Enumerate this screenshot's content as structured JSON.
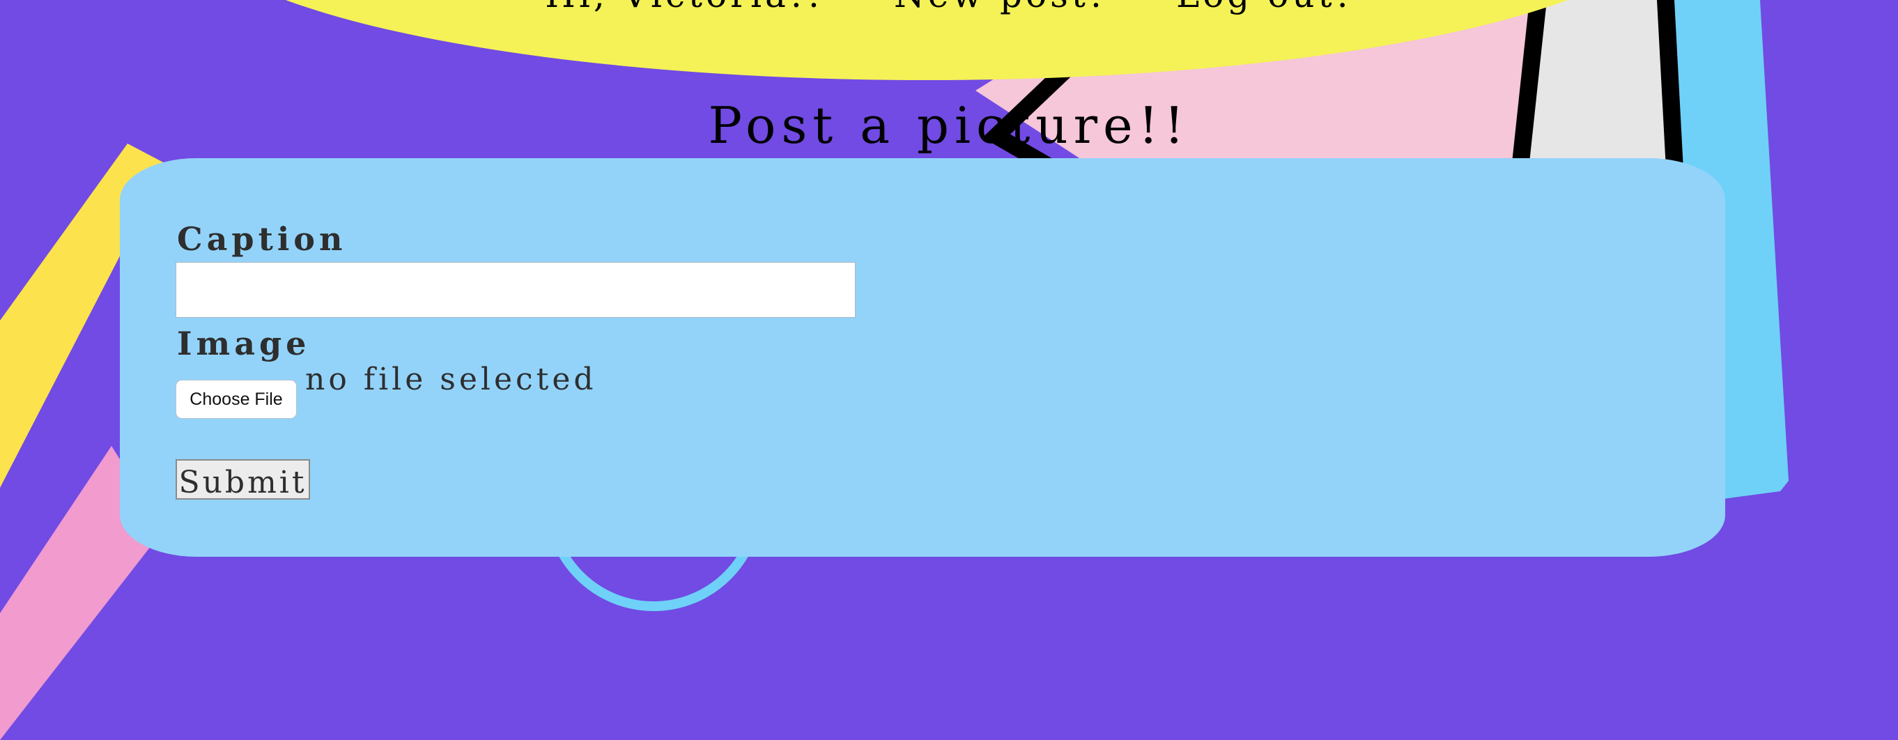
{
  "nav": {
    "greeting": "Hi, Victoria!!",
    "new_post_label": "New post!",
    "logout_label": "Log out!"
  },
  "page": {
    "title": "Post a picture!!"
  },
  "form": {
    "caption_label": "Caption",
    "caption_value": "",
    "image_label": "Image",
    "choose_file_label": "Choose File",
    "file_status": "no file selected",
    "submit_label": "Submit"
  },
  "colors": {
    "background": "#714be3",
    "panel": "#93d3fa",
    "nav_blob": "#f4f257",
    "pink_shape": "#f6c6d9",
    "light_blue_shape": "#6fd1f8",
    "yellow_stripe": "#fce24d",
    "pink_stripe": "#f19bcf"
  }
}
